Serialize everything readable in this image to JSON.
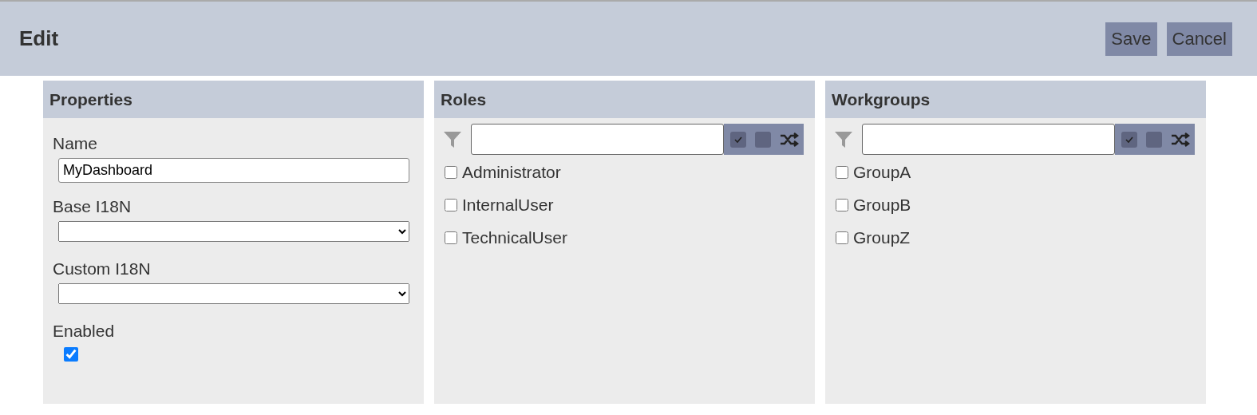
{
  "header": {
    "title": "Edit",
    "buttons": [
      "Save",
      "Cancel"
    ]
  },
  "properties": {
    "title": "Properties",
    "name_label": "Name",
    "name_value": "MyDashboard",
    "base_label": "Base I18N",
    "custom_label": "Custom I18N",
    "enabled_label": "Enabled",
    "enabled": true
  },
  "lists": [
    {
      "title": "Roles",
      "items": [
        {
          "label": "Administrator",
          "checked": false
        },
        {
          "label": "InternalUser",
          "checked": false
        },
        {
          "label": "TechnicalUser",
          "checked": false
        }
      ]
    },
    {
      "title": "Workgroups",
      "items": [
        {
          "label": "GroupA",
          "checked": false
        },
        {
          "label": "GroupB",
          "checked": false
        },
        {
          "label": "GroupZ",
          "checked": false
        }
      ]
    }
  ]
}
